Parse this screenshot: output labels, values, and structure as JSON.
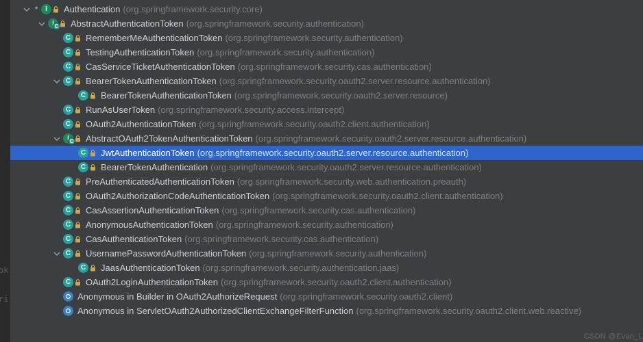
{
  "watermark": "CSDN @Evan_L",
  "left_fragments": {
    "a": "ok",
    "b": "ri"
  },
  "tree": [
    {
      "depth": 0,
      "chev": "down",
      "star": true,
      "icon": "interface",
      "lock": true,
      "name": "Authentication",
      "pkg": "(org.springframework.security.core)",
      "selected": false
    },
    {
      "depth": 1,
      "chev": "down",
      "star": false,
      "icon": "interface",
      "lock": true,
      "overlay": true,
      "name": "AbstractAuthenticationToken",
      "pkg": "(org.springframework.security.authentication)",
      "selected": false
    },
    {
      "depth": 2,
      "chev": "",
      "star": false,
      "icon": "class",
      "lock": true,
      "name": "RememberMeAuthenticationToken",
      "pkg": "(org.springframework.security.authentication)",
      "selected": false
    },
    {
      "depth": 2,
      "chev": "",
      "star": false,
      "icon": "class",
      "lock": true,
      "name": "TestingAuthenticationToken",
      "pkg": "(org.springframework.security.authentication)",
      "selected": false
    },
    {
      "depth": 2,
      "chev": "",
      "star": false,
      "icon": "class",
      "lock": true,
      "name": "CasServiceTicketAuthenticationToken",
      "pkg": "(org.springframework.security.cas.authentication)",
      "selected": false
    },
    {
      "depth": 2,
      "chev": "down",
      "star": false,
      "icon": "class",
      "lock": true,
      "name": "BearerTokenAuthenticationToken",
      "pkg": "(org.springframework.security.oauth2.server.resource.authentication)",
      "selected": false
    },
    {
      "depth": 3,
      "chev": "",
      "star": false,
      "icon": "class",
      "lock": true,
      "name": "BearerTokenAuthenticationToken",
      "pkg": "(org.springframework.security.oauth2.server.resource)",
      "selected": false
    },
    {
      "depth": 2,
      "chev": "",
      "star": false,
      "icon": "class",
      "lock": true,
      "name": "RunAsUserToken",
      "pkg": "(org.springframework.security.access.intercept)",
      "selected": false
    },
    {
      "depth": 2,
      "chev": "",
      "star": false,
      "icon": "class",
      "lock": true,
      "name": "OAuth2AuthenticationToken",
      "pkg": "(org.springframework.security.oauth2.client.authentication)",
      "selected": false
    },
    {
      "depth": 2,
      "chev": "down",
      "star": false,
      "icon": "interface",
      "lock": true,
      "overlay": true,
      "name": "AbstractOAuth2TokenAuthenticationToken",
      "pkg": "(org.springframework.security.oauth2.server.resource.authentication)",
      "selected": false
    },
    {
      "depth": 3,
      "chev": "",
      "star": false,
      "icon": "class",
      "lock": true,
      "name": "JwtAuthenticationToken",
      "pkg": "(org.springframework.security.oauth2.server.resource.authentication)",
      "selected": true
    },
    {
      "depth": 3,
      "chev": "",
      "star": false,
      "icon": "class",
      "lock": true,
      "name": "BearerTokenAuthentication",
      "pkg": "(org.springframework.security.oauth2.server.resource.authentication)",
      "selected": false
    },
    {
      "depth": 2,
      "chev": "",
      "star": false,
      "icon": "class",
      "lock": true,
      "name": "PreAuthenticatedAuthenticationToken",
      "pkg": "(org.springframework.security.web.authentication.preauth)",
      "selected": false
    },
    {
      "depth": 2,
      "chev": "",
      "star": false,
      "icon": "class",
      "lock": true,
      "name": "OAuth2AuthorizationCodeAuthenticationToken",
      "pkg": "(org.springframework.security.oauth2.client.authentication)",
      "selected": false
    },
    {
      "depth": 2,
      "chev": "",
      "star": false,
      "icon": "class",
      "lock": true,
      "name": "CasAssertionAuthenticationToken",
      "pkg": "(org.springframework.security.cas.authentication)",
      "selected": false
    },
    {
      "depth": 2,
      "chev": "",
      "star": false,
      "icon": "class",
      "lock": true,
      "name": "AnonymousAuthenticationToken",
      "pkg": "(org.springframework.security.authentication)",
      "selected": false
    },
    {
      "depth": 2,
      "chev": "",
      "star": false,
      "icon": "class",
      "lock": true,
      "name": "CasAuthenticationToken",
      "pkg": "(org.springframework.security.cas.authentication)",
      "selected": false
    },
    {
      "depth": 2,
      "chev": "down",
      "star": false,
      "icon": "class",
      "lock": true,
      "name": "UsernamePasswordAuthenticationToken",
      "pkg": "(org.springframework.security.authentication)",
      "selected": false
    },
    {
      "depth": 3,
      "chev": "",
      "star": false,
      "icon": "class",
      "lock": true,
      "name": "JaasAuthenticationToken",
      "pkg": "(org.springframework.security.authentication.jaas)",
      "selected": false
    },
    {
      "depth": 2,
      "chev": "",
      "star": false,
      "icon": "class",
      "lock": true,
      "name": "OAuth2LoginAuthenticationToken",
      "pkg": "(org.springframework.security.oauth2.client.authentication)",
      "selected": false
    },
    {
      "depth": 2,
      "chev": "",
      "star": false,
      "icon": "blue",
      "lock": false,
      "name": "Anonymous in Builder in OAuth2AuthorizeRequest",
      "pkg": "(org.springframework.security.oauth2.client)",
      "selected": false
    },
    {
      "depth": 2,
      "chev": "",
      "star": false,
      "icon": "blue",
      "lock": false,
      "name": "Anonymous in ServletOAuth2AuthorizedClientExchangeFilterFunction",
      "pkg": "(org.springframework.security.oauth2.client.web.reactive)",
      "selected": false
    }
  ]
}
